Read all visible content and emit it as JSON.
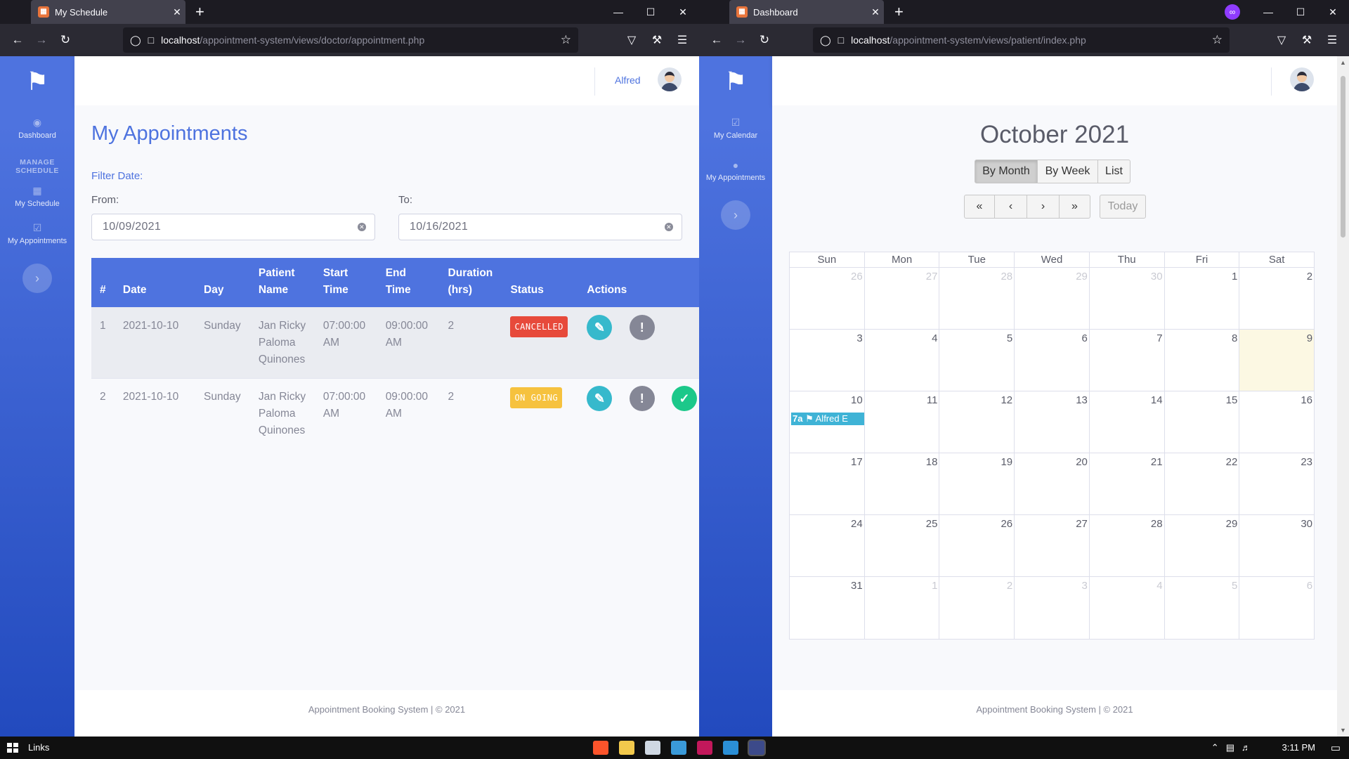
{
  "left_window": {
    "tab_title": "My Schedule",
    "url_host": "localhost",
    "url_path": "/appointment-system/views/doctor/appointment.php",
    "sidebar": {
      "items": [
        {
          "label": "Dashboard"
        },
        {
          "label": "My Schedule"
        },
        {
          "label": "My Appointments"
        }
      ],
      "heading": "MANAGE SCHEDULE"
    },
    "topbar": {
      "user_name": "Alfred"
    },
    "page_title": "My Appointments",
    "filter_label": "Filter Date:",
    "from_label": "From:",
    "to_label": "To:",
    "from_value": "10/09/2021",
    "to_value": "10/16/2021",
    "table": {
      "headers": [
        "#",
        "Date",
        "Day",
        "Patient Name",
        "Start Time",
        "End Time",
        "Duration (hrs)",
        "Status",
        "Actions"
      ],
      "rows": [
        {
          "num": "1",
          "date": "2021-10-10",
          "day": "Sunday",
          "patient": "Jan Ricky Paloma Quinones",
          "start": "07:00:00 AM",
          "end": "09:00:00 AM",
          "duration": "2",
          "status": "CANCELLED"
        },
        {
          "num": "2",
          "date": "2021-10-10",
          "day": "Sunday",
          "patient": "Jan Ricky Paloma Quinones",
          "start": "07:00:00 AM",
          "end": "09:00:00 AM",
          "duration": "2",
          "status": "ON GOING"
        }
      ]
    },
    "footer": "Appointment Booking System | © 2021"
  },
  "right_window": {
    "tab_title": "Dashboard",
    "url_host": "localhost",
    "url_path": "/appointment-system/views/patient/index.php",
    "sidebar": {
      "items": [
        {
          "label": "My Calendar"
        },
        {
          "label": "My Appointments"
        }
      ]
    },
    "calendar": {
      "title": "October 2021",
      "views": [
        "By Month",
        "By Week",
        "List"
      ],
      "today_label": "Today",
      "weekdays": [
        "Sun",
        "Mon",
        "Tue",
        "Wed",
        "Thu",
        "Fri",
        "Sat"
      ],
      "weeks": [
        [
          "26",
          "27",
          "28",
          "29",
          "30",
          "1",
          "2"
        ],
        [
          "3",
          "4",
          "5",
          "6",
          "7",
          "8",
          "9"
        ],
        [
          "10",
          "11",
          "12",
          "13",
          "14",
          "15",
          "16"
        ],
        [
          "17",
          "18",
          "19",
          "20",
          "21",
          "22",
          "23"
        ],
        [
          "24",
          "25",
          "26",
          "27",
          "28",
          "29",
          "30"
        ],
        [
          "31",
          "1",
          "2",
          "3",
          "4",
          "5",
          "6"
        ]
      ],
      "event": {
        "time": "7a",
        "title": "Alfred E"
      }
    },
    "footer": "Appointment Booking System | © 2021"
  },
  "taskbar": {
    "links_label": "Links",
    "time": "3:11 PM"
  },
  "colors": {
    "primary": "#4e73df",
    "danger": "#e74a3b",
    "warning": "#f6c23e",
    "info": "#36b9cc",
    "success": "#1cc88a",
    "secondary": "#858796"
  }
}
